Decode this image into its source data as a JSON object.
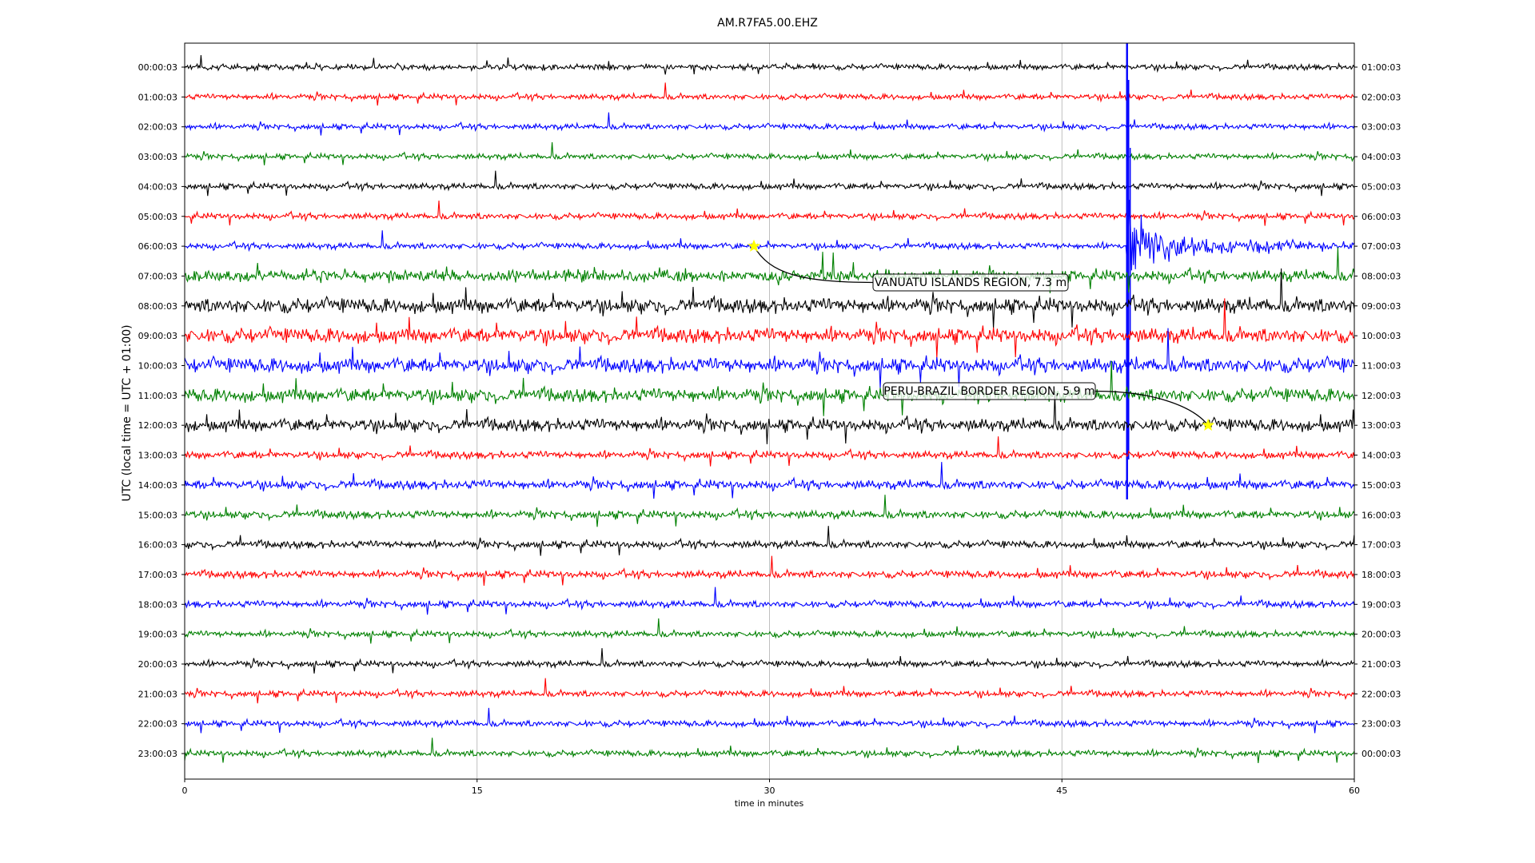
{
  "chart_data": {
    "type": "line",
    "title": "AM.R7FA5.00.EHZ",
    "xlabel": "time in minutes",
    "ylabel": "UTC (local time = UTC + 01:00)",
    "xlim": [
      0,
      60
    ],
    "xticks": [
      "0",
      "15",
      "30",
      "45",
      "60"
    ],
    "xtick_values": [
      0,
      15,
      30,
      45,
      60
    ],
    "grid": "vertical at x ticks",
    "colors": [
      "#000000",
      "#ff0000",
      "#0000ff",
      "#008000"
    ],
    "rows": [
      {
        "left": "00:00:03",
        "right": "01:00:03",
        "amp": 1.0
      },
      {
        "left": "01:00:03",
        "right": "02:00:03",
        "amp": 1.0
      },
      {
        "left": "02:00:03",
        "right": "03:00:03",
        "amp": 1.0
      },
      {
        "left": "03:00:03",
        "right": "04:00:03",
        "amp": 1.0
      },
      {
        "left": "04:00:03",
        "right": "05:00:03",
        "amp": 1.1
      },
      {
        "left": "05:00:03",
        "right": "06:00:03",
        "amp": 1.1
      },
      {
        "left": "06:00:03",
        "right": "07:00:03",
        "amp": 1.1
      },
      {
        "left": "07:00:03",
        "right": "08:00:03",
        "amp": 2.0
      },
      {
        "left": "08:00:03",
        "right": "09:00:03",
        "amp": 2.6
      },
      {
        "left": "09:00:03",
        "right": "10:00:03",
        "amp": 2.6
      },
      {
        "left": "10:00:03",
        "right": "11:00:03",
        "amp": 2.6
      },
      {
        "left": "11:00:03",
        "right": "12:00:03",
        "amp": 2.4
      },
      {
        "left": "12:00:03",
        "right": "13:00:03",
        "amp": 2.2
      },
      {
        "left": "13:00:03",
        "right": "14:00:03",
        "amp": 1.3
      },
      {
        "left": "14:00:03",
        "right": "15:00:03",
        "amp": 1.6
      },
      {
        "left": "15:00:03",
        "right": "16:00:03",
        "amp": 1.4
      },
      {
        "left": "16:00:03",
        "right": "17:00:03",
        "amp": 1.3
      },
      {
        "left": "17:00:03",
        "right": "18:00:03",
        "amp": 1.3
      },
      {
        "left": "18:00:03",
        "right": "19:00:03",
        "amp": 1.2
      },
      {
        "left": "19:00:03",
        "right": "20:00:03",
        "amp": 1.1
      },
      {
        "left": "20:00:03",
        "right": "21:00:03",
        "amp": 1.1
      },
      {
        "left": "21:00:03",
        "right": "22:00:03",
        "amp": 1.1
      },
      {
        "left": "22:00:03",
        "right": "23:00:03",
        "amp": 1.1
      },
      {
        "left": "23:00:03",
        "right": "00:00:03",
        "amp": 1.1
      }
    ],
    "events": [
      {
        "label": "VANUATU ISLANDS REGION, 7.3 m",
        "row": 6,
        "minute": 29.2,
        "marker_color": "#ffff00"
      },
      {
        "label": "PERU-BRAZIL BORDER REGION, 5.9 m",
        "row": 12,
        "minute": 52.5,
        "marker_color": "#ffff00"
      }
    ],
    "big_quake": {
      "row": 6,
      "onset_minute": 48.3
    }
  }
}
